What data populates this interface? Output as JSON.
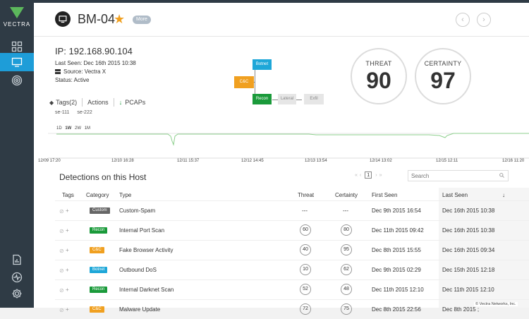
{
  "brand": {
    "logo_text": "VECTRA"
  },
  "sidebar": {
    "items": [
      {
        "icon": "grid-icon"
      },
      {
        "icon": "monitor-icon",
        "active": true
      },
      {
        "icon": "target-icon"
      },
      {
        "icon": "report-icon"
      },
      {
        "icon": "activity-icon"
      },
      {
        "icon": "gear-icon"
      }
    ]
  },
  "header": {
    "host_name": "BM-04",
    "more_label": "More",
    "prev_arrow": "‹",
    "next_arrow": "›"
  },
  "host": {
    "ip": "IP: 192.168.90.104",
    "last_seen": "Last Seen: Dec 16th 2015 10:38",
    "source": "Source: Vectra X",
    "status": "Status: Active"
  },
  "actions": {
    "tags_label": "Tags(2)",
    "actions_label": "Actions",
    "pcaps_label": "PCAPs",
    "tags": [
      "se-111",
      "se-222"
    ]
  },
  "kill_chain": {
    "cc": "C&C",
    "botnet": "Botnet",
    "recon": "Recon",
    "lateral": "Lateral",
    "exfil": "Exfil",
    "colors": {
      "cc": "#f0a020",
      "botnet": "#1ea7d8",
      "recon": "#1a9a3a",
      "inactive": "#e6e6e6"
    }
  },
  "scores": {
    "threat_label": "THREAT",
    "threat": "90",
    "certainty_label": "CERTAINTY",
    "certainty": "97"
  },
  "timeline": {
    "ranges": [
      "1D",
      "1W",
      "2W",
      "1M"
    ],
    "selected_range": "1W",
    "ticks": [
      "12/09 17:20",
      "12/10 16:28",
      "12/11 15:37",
      "12/12 14:45",
      "12/13 13:54",
      "12/14 13:02",
      "12/15 12:11",
      "12/16 11:20"
    ]
  },
  "detections": {
    "title": "Detections on this Host",
    "page": "1",
    "search_placeholder": "Search",
    "columns": {
      "tags": "Tags",
      "category": "Category",
      "type": "Type",
      "threat": "Threat",
      "certainty": "Certainty",
      "first_seen": "First Seen",
      "last_seen": "Last Seen",
      "sort": "↓"
    },
    "rows": [
      {
        "tag": "+",
        "category": "Custom",
        "cat_color": "#666666",
        "type": "Custom-Spam",
        "threat": "---",
        "certainty": "---",
        "first_seen": "Dec 9th 2015 16:54",
        "last_seen": "Dec 16th 2015 10:38"
      },
      {
        "tag": "+",
        "category": "Recon",
        "cat_color": "#1a9a3a",
        "type": "Internal Port Scan",
        "threat": "60",
        "certainty": "80",
        "first_seen": "Dec 11th 2015 09:42",
        "last_seen": "Dec 16th 2015 10:38"
      },
      {
        "tag": "+",
        "category": "C&C",
        "cat_color": "#f0a020",
        "type": "Fake Browser Activity",
        "threat": "40",
        "certainty": "95",
        "first_seen": "Dec 8th 2015 15:55",
        "last_seen": "Dec 16th 2015 09:34"
      },
      {
        "tag": "+",
        "category": "Botnet",
        "cat_color": "#1ea7d8",
        "type": "Outbound DoS",
        "threat": "10",
        "certainty": "62",
        "first_seen": "Dec 9th 2015 02:29",
        "last_seen": "Dec 15th 2015 12:18"
      },
      {
        "tag": "+",
        "category": "Recon",
        "cat_color": "#1a9a3a",
        "type": "Internal Darknet Scan",
        "threat": "52",
        "certainty": "48",
        "first_seen": "Dec 11th 2015 12:10",
        "last_seen": "Dec 11th 2015 12:10"
      },
      {
        "tag": "+",
        "category": "C&C",
        "cat_color": "#f0a020",
        "type": "Malware Update",
        "threat": "72",
        "certainty": "75",
        "first_seen": "Dec 8th 2015 22:56",
        "last_seen": "Dec 8th 2015 ;"
      }
    ]
  },
  "footer": {
    "copyright": "© Vectra Networks, Inc."
  }
}
